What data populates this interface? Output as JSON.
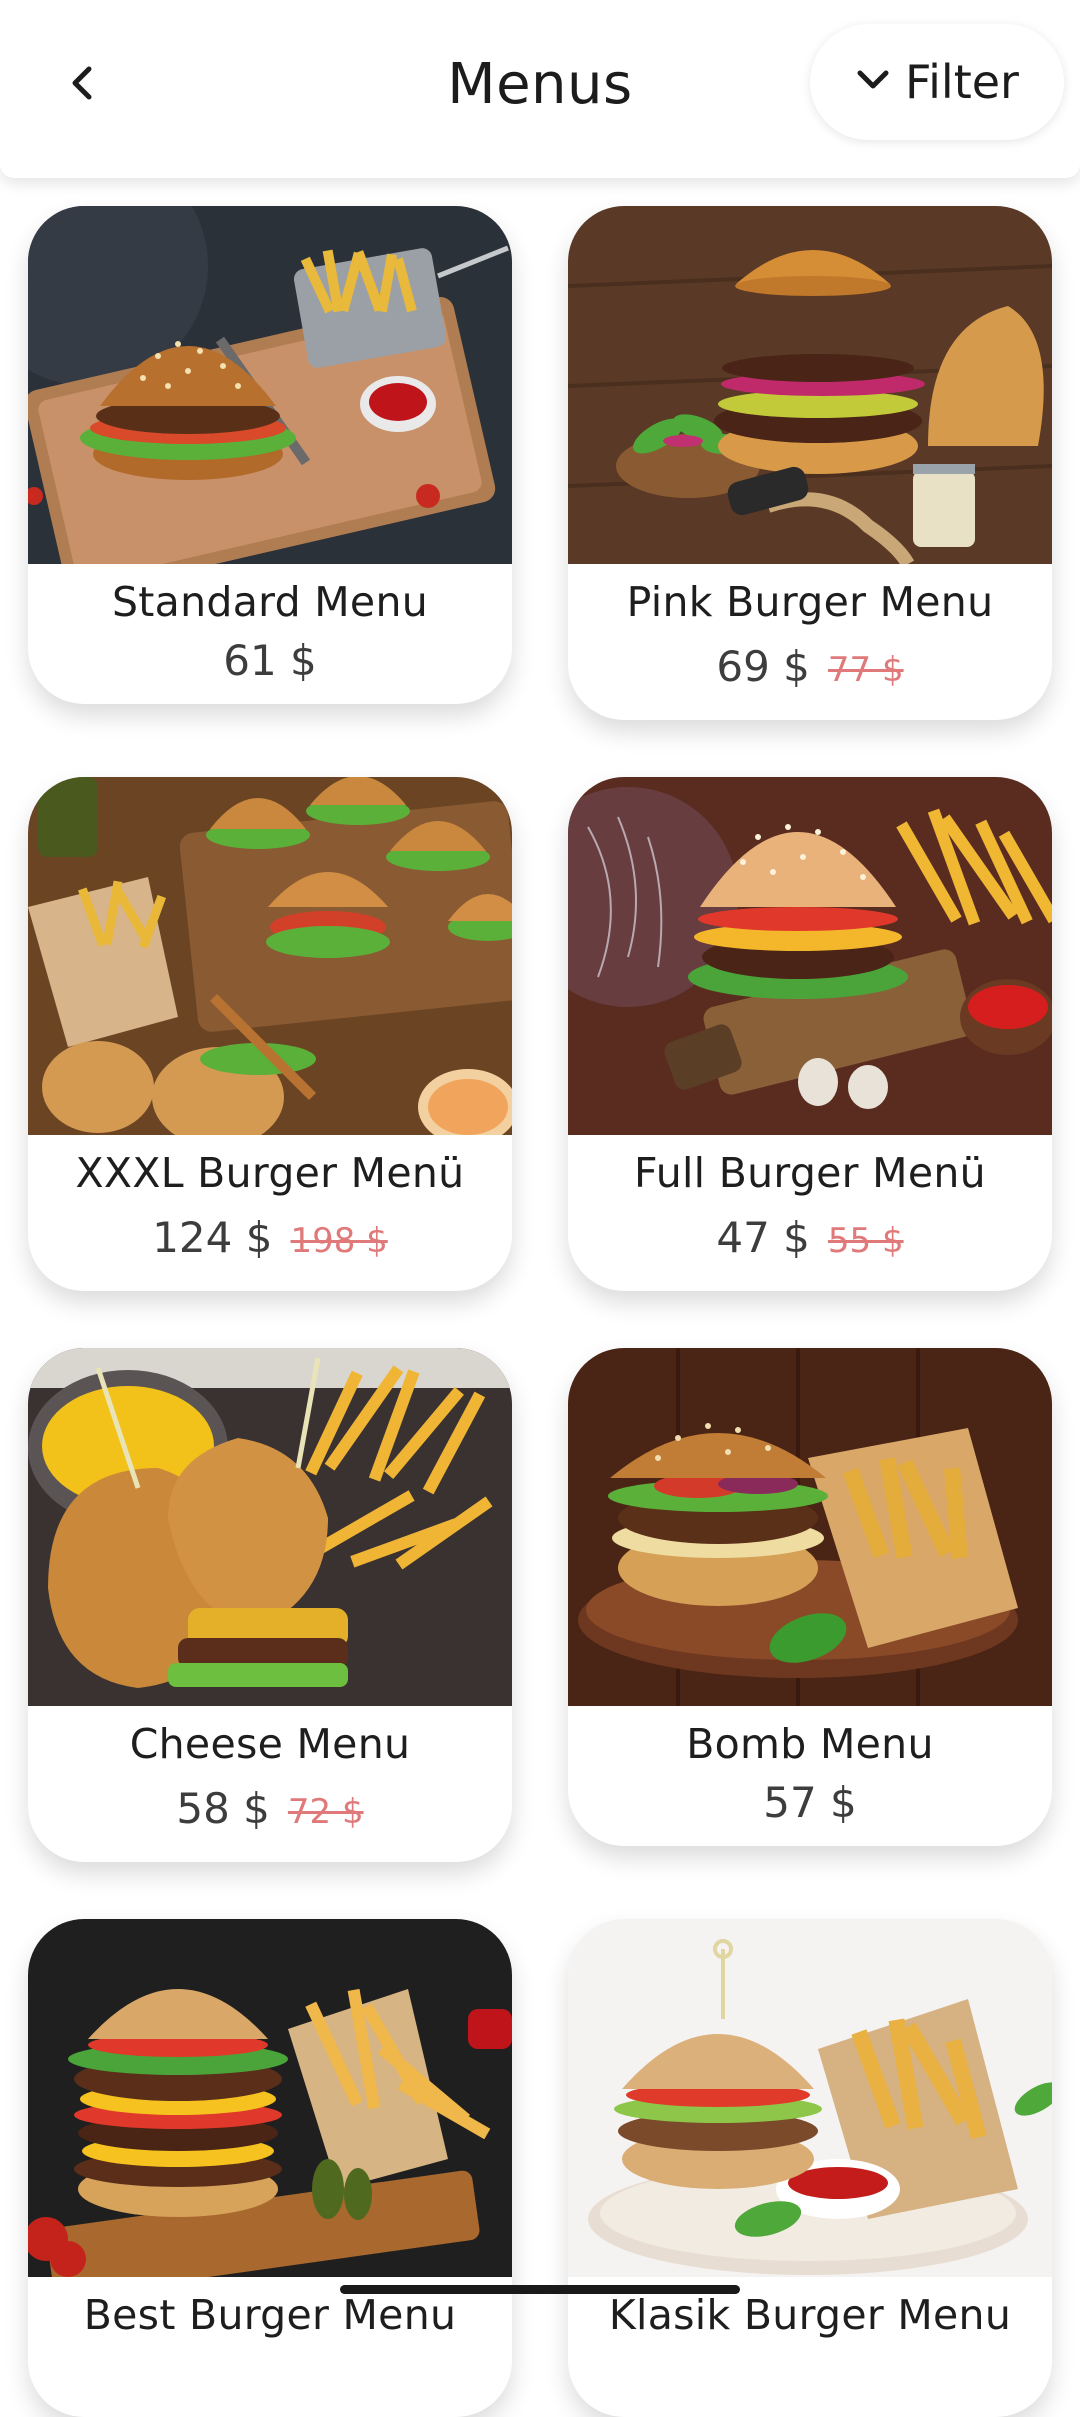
{
  "header": {
    "title": "Menus",
    "back_icon": "chevron-left-icon",
    "filter_label": "Filter",
    "filter_icon": "chevron-down-icon"
  },
  "menus": [
    {
      "name": "Standard Menu",
      "price": "61 $",
      "old_price": ""
    },
    {
      "name": "Pink Burger Menu",
      "price": "69 $",
      "old_price": "77 $"
    },
    {
      "name": "XXXL Burger Menü",
      "price": "124 $",
      "old_price": "198 $"
    },
    {
      "name": "Full Burger Menü",
      "price": "47 $",
      "old_price": "55 $"
    },
    {
      "name": "Cheese Menu",
      "price": "58 $",
      "old_price": "72 $"
    },
    {
      "name": "Bomb Menu",
      "price": "57 $",
      "old_price": ""
    },
    {
      "name": "Best Burger Menu",
      "price": "",
      "old_price": ""
    },
    {
      "name": "Klasik Burger Menu",
      "price": "",
      "old_price": ""
    }
  ],
  "colors": {
    "old_price": "#e07a7a",
    "price": "#3d3d3d",
    "background": "#ffffff"
  }
}
